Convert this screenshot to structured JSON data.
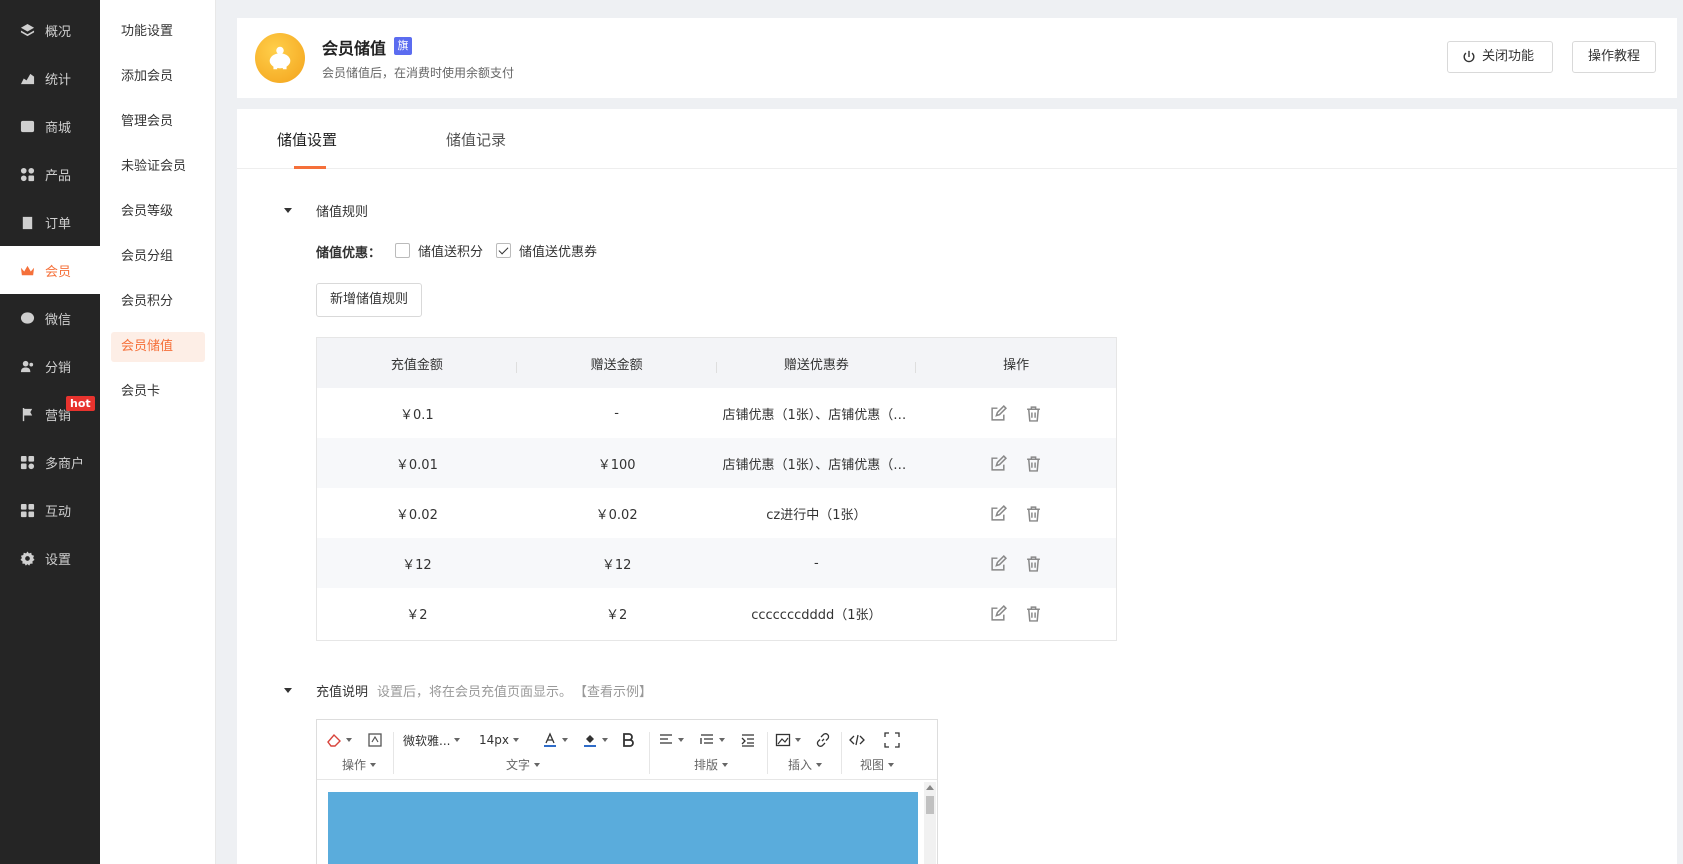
{
  "nav": {
    "items": [
      {
        "label": "概况",
        "icon": "layers-icon"
      },
      {
        "label": "统计",
        "icon": "chart-icon"
      },
      {
        "label": "商城",
        "icon": "shop-icon"
      },
      {
        "label": "产品",
        "icon": "grid-icon"
      },
      {
        "label": "订单",
        "icon": "clipboard-icon"
      },
      {
        "label": "会员",
        "icon": "crown-icon"
      },
      {
        "label": "微信",
        "icon": "wechat-icon"
      },
      {
        "label": "分销",
        "icon": "users-icon"
      },
      {
        "label": "营销",
        "icon": "flag-icon"
      },
      {
        "label": "多商户",
        "icon": "store-icon"
      },
      {
        "label": "互动",
        "icon": "apps-icon"
      },
      {
        "label": "设置",
        "icon": "gear-icon"
      }
    ],
    "badge": "hot"
  },
  "submenu": {
    "items": [
      "功能设置",
      "添加会员",
      "管理会员",
      "未验证会员",
      "会员等级",
      "会员分组",
      "会员积分",
      "会员储值",
      "会员卡"
    ]
  },
  "header": {
    "title": "会员储值",
    "tag": "旗",
    "desc": "会员储值后，在消费时使用余额支付",
    "close_button": "关闭功能",
    "tutorial_button": "操作教程"
  },
  "tabs": [
    "储值设置",
    "储值记录"
  ],
  "rules": {
    "section_title": "储值规则",
    "discount_label": "储值优惠：",
    "options": [
      {
        "label": "储值送积分",
        "checked": false
      },
      {
        "label": "储值送优惠券",
        "checked": true
      }
    ],
    "add_button": "新增储值规则",
    "columns": [
      "充值金额",
      "赠送金额",
      "赠送优惠券",
      "操作"
    ],
    "rows": [
      {
        "amount": "￥0.1",
        "bonus": "-",
        "coupon": "店铺优惠（1张）、店铺优惠（1..."
      },
      {
        "amount": "￥0.01",
        "bonus": "￥100",
        "coupon": "店铺优惠（1张）、店铺优惠（1..."
      },
      {
        "amount": "￥0.02",
        "bonus": "￥0.02",
        "coupon": "cz进行中（1张）"
      },
      {
        "amount": "￥12",
        "bonus": "￥12",
        "coupon": "-"
      },
      {
        "amount": "￥2",
        "bonus": "￥2",
        "coupon": "cccccccdddd（1张）"
      }
    ]
  },
  "description": {
    "title": "充值说明",
    "hint": "设置后，将在会员充值页面显示。",
    "example": "【查看示例】"
  },
  "editor": {
    "font_family": "微软雅...",
    "font_size": "14px",
    "groups": [
      "操作",
      "文字",
      "排版",
      "插入",
      "视图"
    ],
    "accent_color": "#5aacdc"
  },
  "colors": {
    "accent": "#f5703a",
    "nav_bg": "#252525",
    "badge": "#e8332e",
    "tag": "#5b6cf0"
  }
}
